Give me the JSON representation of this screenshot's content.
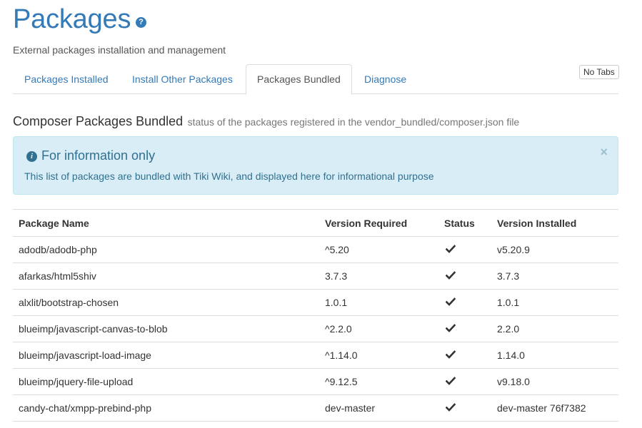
{
  "header": {
    "title": "Packages",
    "help_icon": "question-circle-icon",
    "subtitle": "External packages installation and management"
  },
  "no_tabs_label": "No Tabs",
  "tabs": [
    {
      "label": "Packages Installed",
      "active": false
    },
    {
      "label": "Install Other Packages",
      "active": false
    },
    {
      "label": "Packages Bundled",
      "active": true
    },
    {
      "label": "Diagnose",
      "active": false
    }
  ],
  "section": {
    "title": "Composer Packages Bundled",
    "subtitle": "status of the packages registered in the vendor_bundled/composer.json file"
  },
  "alert": {
    "icon": "info-circle-icon",
    "title": "For information only",
    "body": "This list of packages are bundled with Tiki Wiki, and displayed here for informational purpose",
    "close": "×"
  },
  "table": {
    "headers": [
      "Package Name",
      "Version Required",
      "Status",
      "Version Installed"
    ],
    "rows": [
      {
        "name": "adodb/adodb-php",
        "required": "^5.20",
        "status": "check-icon",
        "installed": "v5.20.9"
      },
      {
        "name": "afarkas/html5shiv",
        "required": "3.7.3",
        "status": "check-icon",
        "installed": "3.7.3"
      },
      {
        "name": "alxlit/bootstrap-chosen",
        "required": "1.0.1",
        "status": "check-icon",
        "installed": "1.0.1"
      },
      {
        "name": "blueimp/javascript-canvas-to-blob",
        "required": "^2.2.0",
        "status": "check-icon",
        "installed": "2.2.0"
      },
      {
        "name": "blueimp/javascript-load-image",
        "required": "^1.14.0",
        "status": "check-icon",
        "installed": "1.14.0"
      },
      {
        "name": "blueimp/jquery-file-upload",
        "required": "^9.12.5",
        "status": "check-icon",
        "installed": "v9.18.0"
      },
      {
        "name": "candy-chat/xmpp-prebind-php",
        "required": "dev-master",
        "status": "check-icon",
        "installed": "dev-master 76f7382"
      }
    ]
  },
  "colors": {
    "link": "#337ab7",
    "alert_bg": "#d9edf7",
    "alert_text": "#31708f",
    "border": "#dddddd"
  }
}
